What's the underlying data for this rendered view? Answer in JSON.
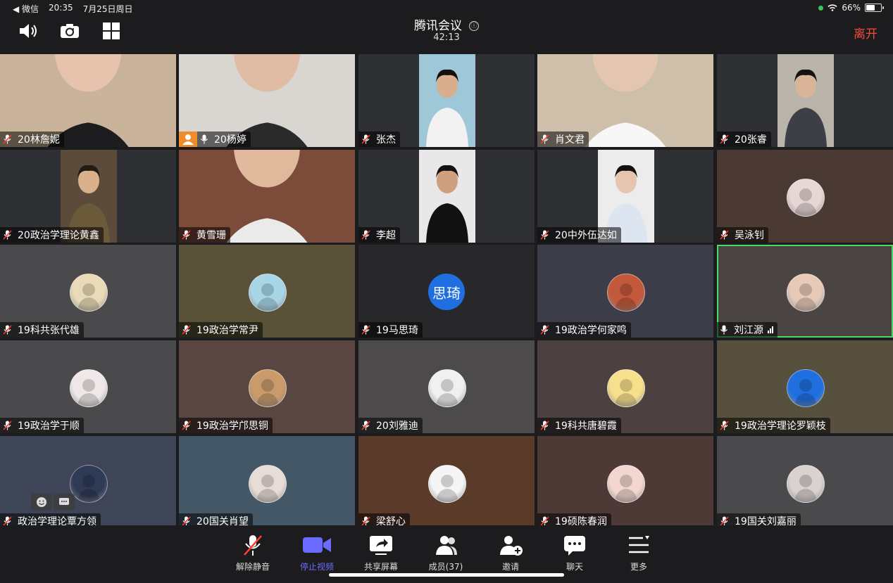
{
  "status_bar": {
    "back_app": "◀ 微信",
    "time": "20:35",
    "date": "7月25日周日",
    "battery": "66%",
    "battery_level": 0.66
  },
  "header": {
    "title": "腾讯会议",
    "info_icon": "ⓘ",
    "timer": "42:13",
    "leave_label": "离开",
    "icons": [
      "speaker-icon",
      "camera-switch-icon",
      "grid-view-icon"
    ]
  },
  "colors": {
    "leave": "#f34a3f",
    "active_border": "#4cd964",
    "active_button": "#6b6bff",
    "avatar_text_bg": "#1f6fe0"
  },
  "participants": [
    {
      "name": "20林詹妮",
      "type": "video",
      "bg": "#c9b39a"
    },
    {
      "name": "20杨婷",
      "type": "video",
      "bg": "#d9d6d2",
      "mic": "on",
      "user_tag": true
    },
    {
      "name": "张杰",
      "type": "video",
      "bg": "#2f3033"
    },
    {
      "name": "肖文君",
      "type": "video",
      "bg": "#cdbfa9"
    },
    {
      "name": "20张睿",
      "type": "video",
      "bg": "#2f3033"
    },
    {
      "name": "20政治学理论黄鑫",
      "type": "video",
      "bg": "#2f3033"
    },
    {
      "name": "黄雪珊",
      "type": "video",
      "bg": "#7c4b3a"
    },
    {
      "name": "李超",
      "type": "video",
      "bg": "#2f3033"
    },
    {
      "name": "20中外伍达如",
      "type": "video",
      "bg": "#2f3033"
    },
    {
      "name": "吴泳钊",
      "type": "avatar",
      "bg": "#4a3a33"
    },
    {
      "name": "19科共张代雄",
      "type": "avatar",
      "bg": "#4a4a4c"
    },
    {
      "name": "19政治学常尹",
      "type": "avatar",
      "bg": "#5a5238"
    },
    {
      "name": "19马思琦",
      "type": "text-avatar",
      "avatar_text": "思琦",
      "bg": "#28282a"
    },
    {
      "name": "19政治学何家鸣",
      "type": "avatar",
      "bg": "#3c3d48"
    },
    {
      "name": "刘江源",
      "type": "avatar",
      "bg": "#4a4442",
      "mic": "on",
      "active": true
    },
    {
      "name": "19政治学于顺",
      "type": "avatar",
      "bg": "#4a4a4c"
    },
    {
      "name": "19政治学邝思铜",
      "type": "avatar",
      "bg": "#5a4640"
    },
    {
      "name": "20刘雅迪",
      "type": "avatar",
      "bg": "#4c4a4a"
    },
    {
      "name": "19科共唐碧霞",
      "type": "avatar",
      "bg": "#4d4040"
    },
    {
      "name": "19政治学理论罗颖枝",
      "type": "avatar",
      "bg": "#57503f"
    },
    {
      "name": "政治学理论覃方领",
      "type": "avatar",
      "bg": "#3d4556"
    },
    {
      "name": "20国关肖望",
      "type": "avatar",
      "bg": "#445766"
    },
    {
      "name": "梁舒心",
      "type": "avatar",
      "bg": "#5a3a28"
    },
    {
      "name": "19硕陈春润",
      "type": "avatar",
      "bg": "#4d3a36"
    },
    {
      "name": "19国关刘嘉丽",
      "type": "avatar",
      "bg": "#4a4a4c"
    }
  ],
  "toolbar": [
    {
      "label": "解除静音",
      "icon": "mic-muted-icon"
    },
    {
      "label": "停止视频",
      "icon": "video-camera-icon",
      "active": true
    },
    {
      "label": "共享屏幕",
      "icon": "share-screen-icon"
    },
    {
      "label": "成员(37)",
      "icon": "members-icon"
    },
    {
      "label": "邀请",
      "icon": "invite-icon"
    },
    {
      "label": "聊天",
      "icon": "chat-icon"
    },
    {
      "label": "更多",
      "icon": "more-icon"
    }
  ]
}
